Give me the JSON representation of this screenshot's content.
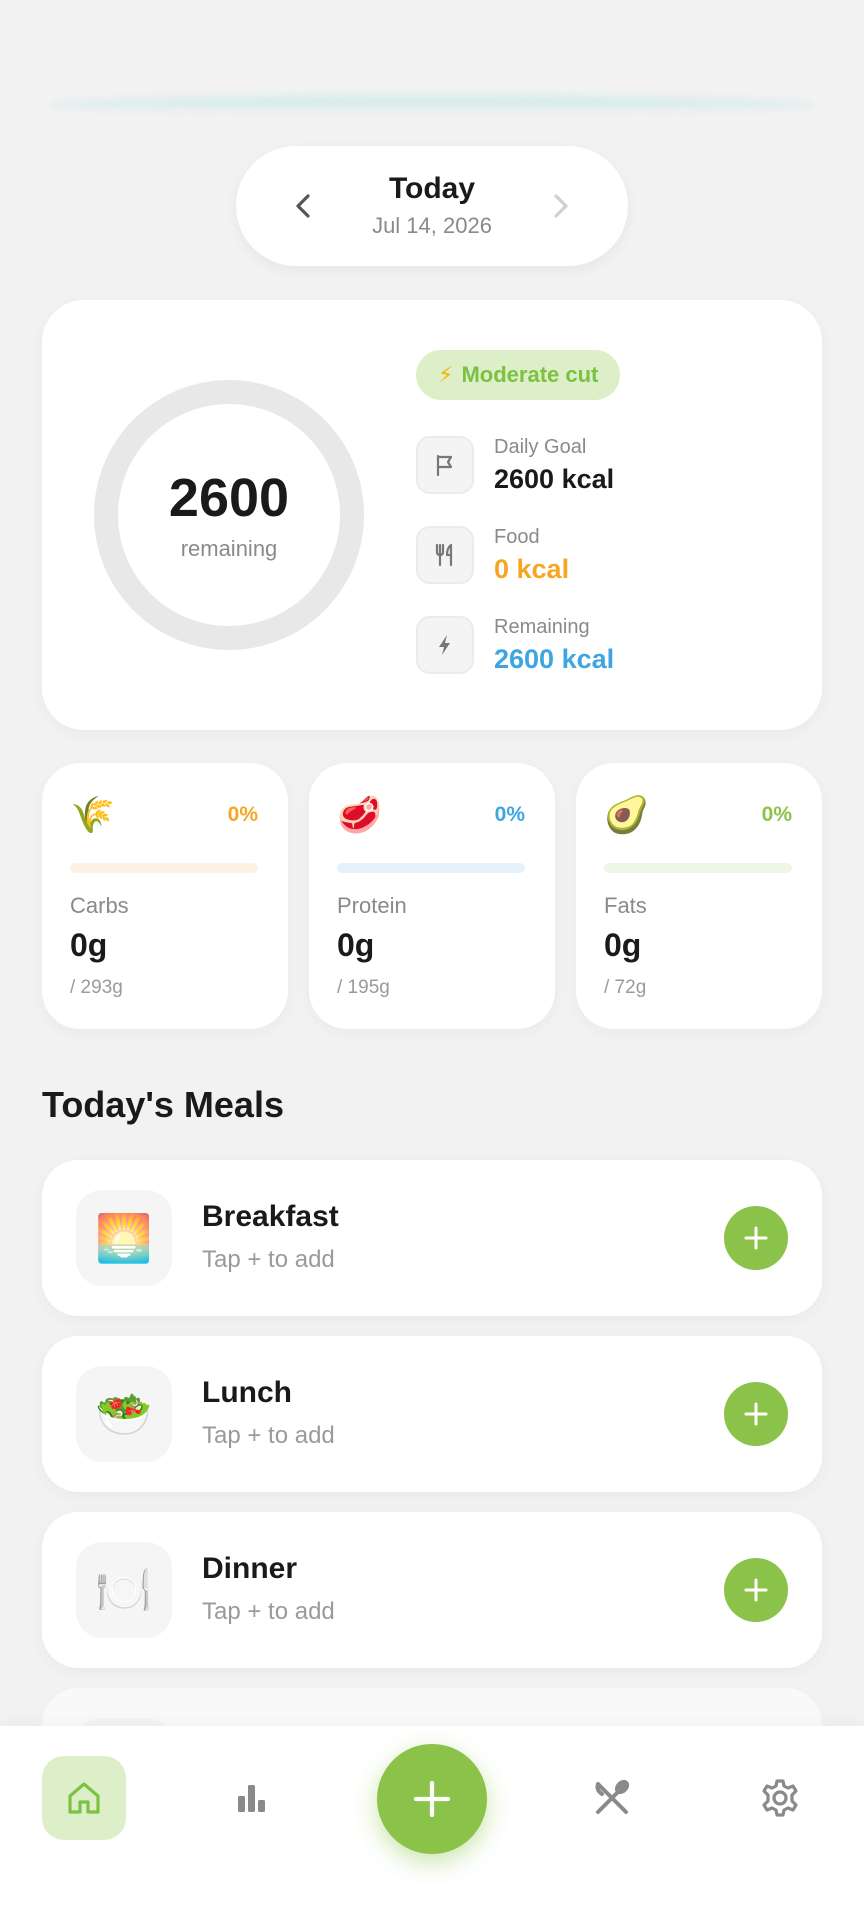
{
  "date": {
    "title": "Today",
    "subtitle": "Jul 14, 2026"
  },
  "summary": {
    "ring_value": "2600",
    "ring_label": "remaining",
    "badge": "Moderate cut",
    "goal": {
      "label": "Daily Goal",
      "value": "2600 kcal"
    },
    "food": {
      "label": "Food",
      "value": "0 kcal"
    },
    "remaining": {
      "label": "Remaining",
      "value": "2600 kcal"
    }
  },
  "macros": [
    {
      "name": "Carbs",
      "emoji": "🌾",
      "percent": "0%",
      "value": "0g",
      "goal": "/ 293g",
      "color": "#f5a623",
      "track": "#fdf1e2",
      "progress": 0
    },
    {
      "name": "Protein",
      "emoji": "🥩",
      "percent": "0%",
      "value": "0g",
      "goal": "/ 195g",
      "color": "#3da5e0",
      "track": "#e6f2fb",
      "progress": 0
    },
    {
      "name": "Fats",
      "emoji": "🥑",
      "percent": "0%",
      "value": "0g",
      "goal": "/ 72g",
      "color": "#8bc34a",
      "track": "#eef6e6",
      "progress": 0
    }
  ],
  "meals_section_title": "Today's Meals",
  "meals": [
    {
      "name": "Breakfast",
      "sub": "Tap + to add",
      "emoji": "🌅"
    },
    {
      "name": "Lunch",
      "sub": "Tap + to add",
      "emoji": "🥗"
    },
    {
      "name": "Dinner",
      "sub": "Tap + to add",
      "emoji": "🍽️"
    }
  ],
  "colors": {
    "accent": "#8bc34a",
    "food": "#f5a623",
    "remaining": "#3da5e0"
  },
  "icons": {
    "nav": [
      "home-icon",
      "stats-icon",
      "add-icon",
      "meals-icon",
      "settings-icon"
    ]
  }
}
